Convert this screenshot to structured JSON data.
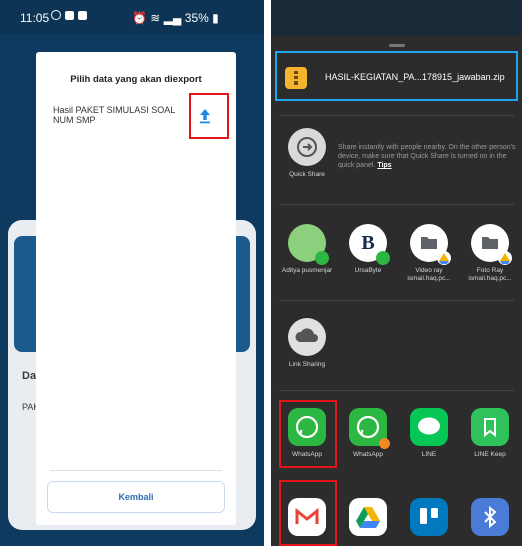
{
  "left": {
    "status": {
      "time": "11:05",
      "battery": "35%"
    },
    "background": {
      "section_label": "Dat",
      "row_label": "PAK"
    },
    "dialog": {
      "title": "Pilih data yang akan diexport",
      "item": "Hasil PAKET SIMULASI SOAL NUM SMP",
      "export_icon": "upload-icon",
      "button_label": "Kembali"
    }
  },
  "right": {
    "file_name": "HASIL-KEGIATAN_PA...178915_jawaban.zip",
    "quick_share": {
      "label": "Quick Share",
      "description": "Share instantly with people nearby. On the other person's device, make sure that Quick Share is turned on in the quick panel.",
      "link": "Tips"
    },
    "contacts": [
      {
        "label": "Aditya pusmenjar"
      },
      {
        "label": "UrsaByte"
      },
      {
        "label": "Video ray ismail.haq.pc..."
      },
      {
        "label": "Foto Ray ismail.haq.pc..."
      }
    ],
    "link_sharing": "Link Sharing",
    "apps": [
      {
        "label": "WhatsApp"
      },
      {
        "label": "WhatsApp"
      },
      {
        "label": "LINE"
      },
      {
        "label": "LINE Keep"
      }
    ],
    "bottom_apps": [
      "gmail-icon",
      "google-drive-icon",
      "trello-icon",
      "bluetooth-icon"
    ]
  },
  "colors": {
    "highlight_red": "#e4141b",
    "highlight_blue": "#1ba6ee",
    "whatsapp_green": "#2bb741",
    "line_green": "#06c755"
  }
}
